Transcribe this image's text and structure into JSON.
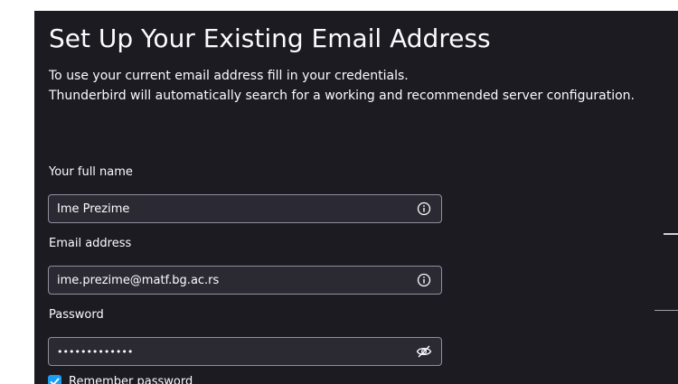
{
  "dialog": {
    "title": "Set Up Your Existing Email Address",
    "description_line1": "To use your current email address fill in your credentials.",
    "description_line2": "Thunderbird will automatically search for a working and recommended server configuration."
  },
  "form": {
    "full_name": {
      "label": "Your full name",
      "value": "Ime Prezime",
      "icon": "info-icon"
    },
    "email": {
      "label": "Email address",
      "value": "ime.prezime@matf.bg.ac.rs",
      "icon": "info-icon"
    },
    "password": {
      "label": "Password",
      "value": "•••••••••••••",
      "icon": "eye-hidden-icon"
    },
    "remember_password": {
      "label": "Remember password",
      "checked": true
    }
  },
  "colors": {
    "background": "#1c1b22",
    "field_background": "#2b2a33",
    "field_border": "#8f8f9d",
    "text": "#fbfbfe",
    "accent": "#1a9df4"
  }
}
